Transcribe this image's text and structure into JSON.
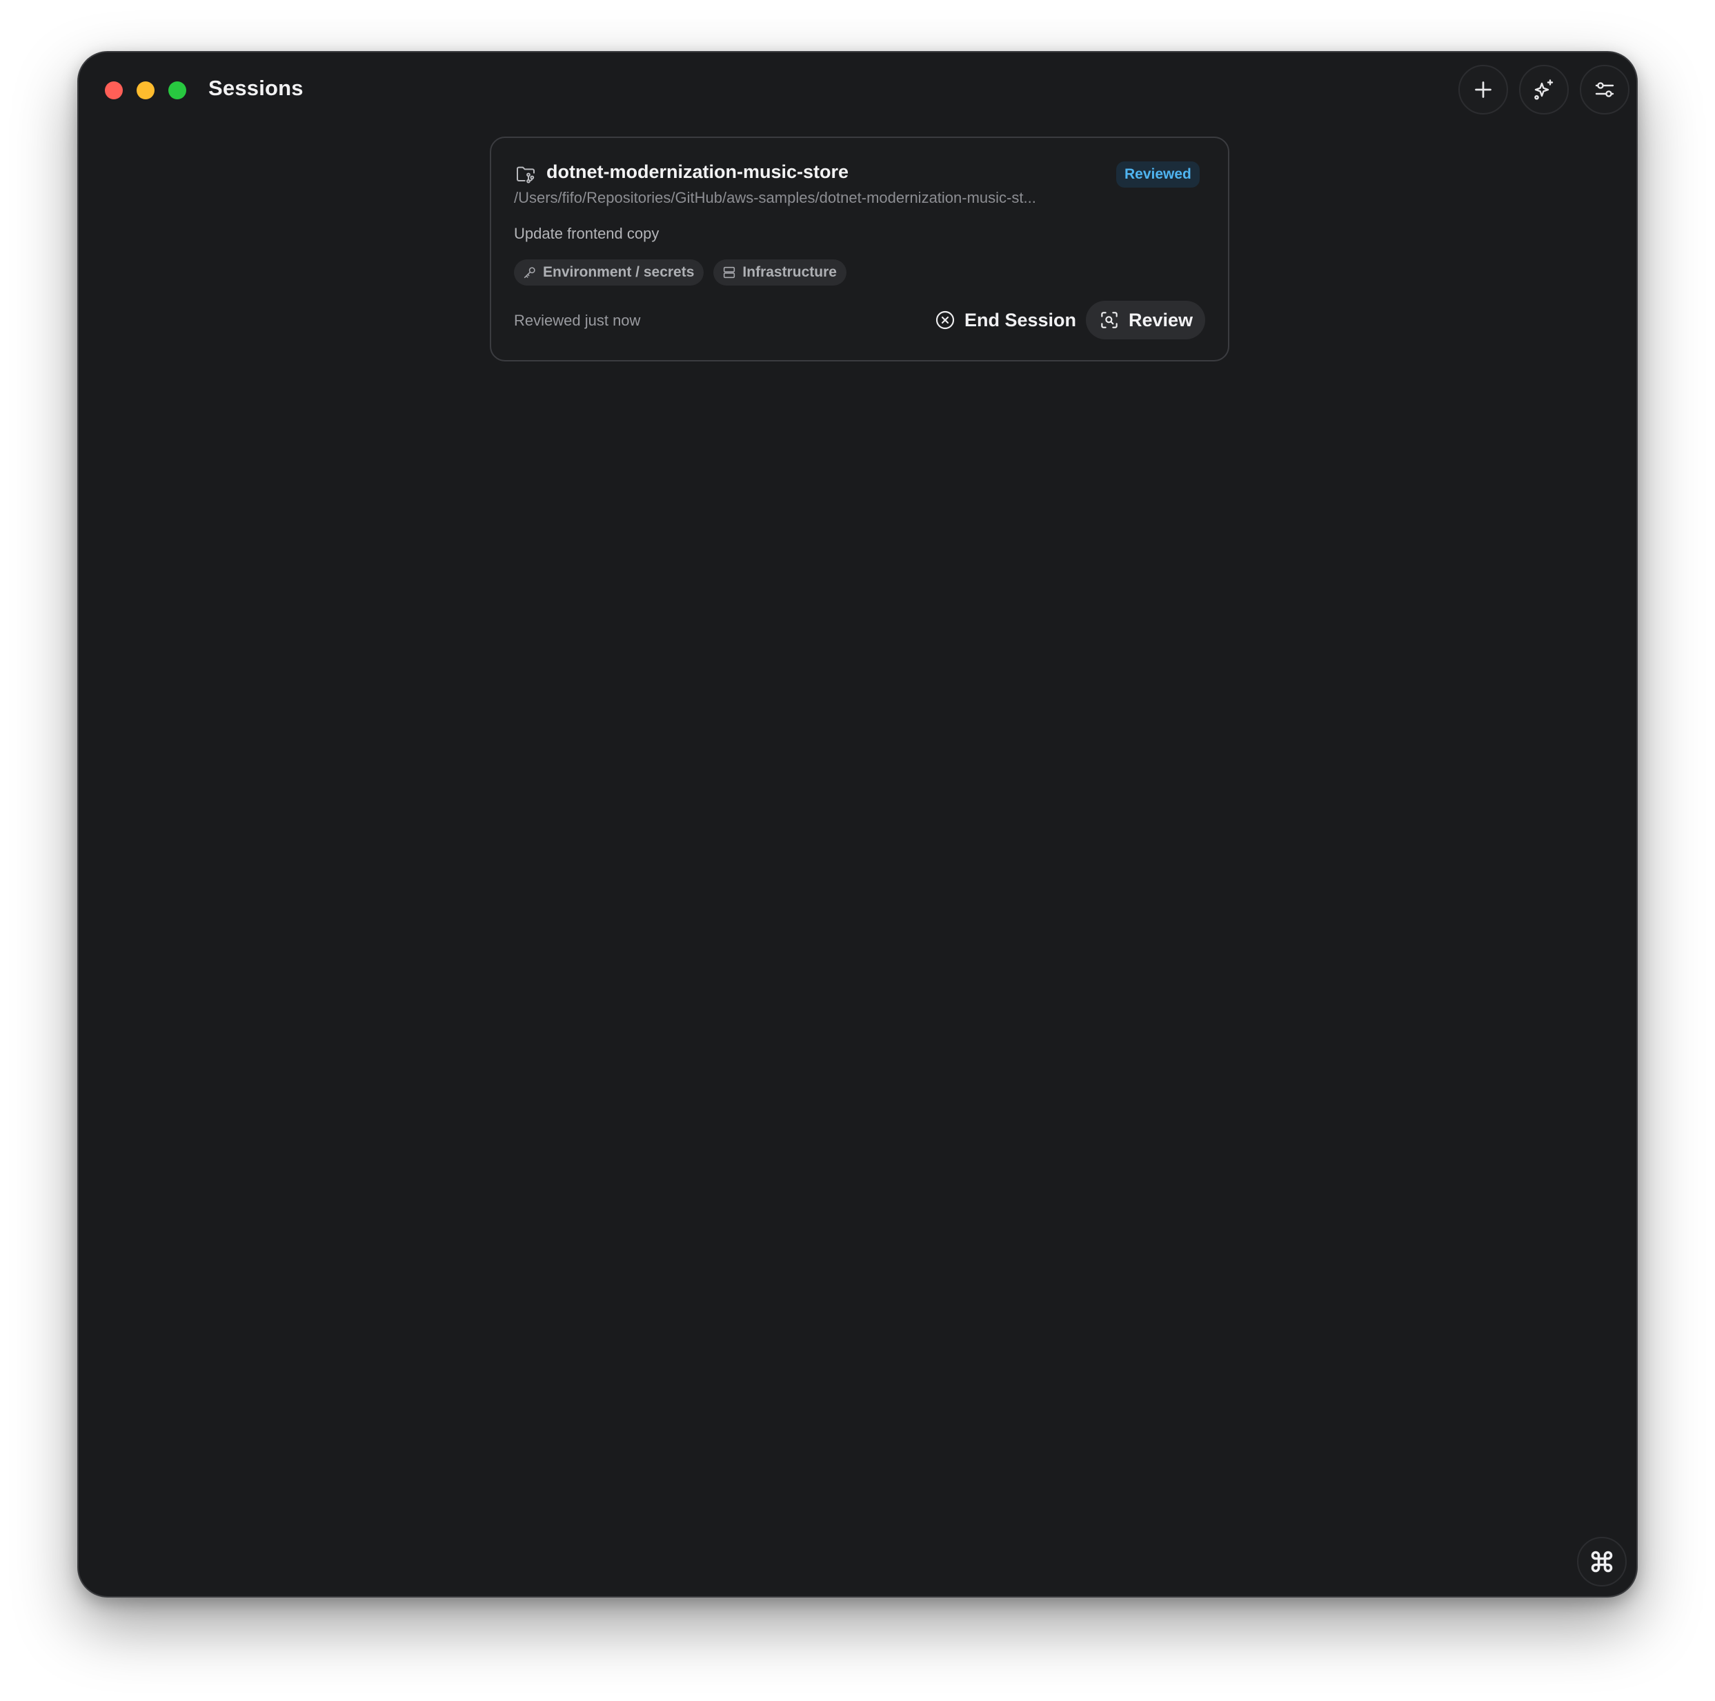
{
  "window": {
    "title": "Sessions"
  },
  "toolbar": {
    "buttons": [
      {
        "name": "new-session",
        "icon": "plus-icon"
      },
      {
        "name": "sparkle",
        "icon": "sparkles-icon"
      },
      {
        "name": "filter",
        "icon": "sliders-icon"
      }
    ]
  },
  "session": {
    "repo_name": "dotnet-modernization-music-store",
    "status": "Reviewed",
    "path": "/Users/fifo/Repositories/GitHub/aws-samples/dotnet-modernization-music-st...",
    "task": "Update frontend copy",
    "tags": [
      {
        "label": "Environment / secrets",
        "icon": "key-icon"
      },
      {
        "label": "Infrastructure",
        "icon": "server-icon"
      }
    ],
    "reviewed_time": "Reviewed just now",
    "end_label": "End Session",
    "review_label": "Review"
  },
  "colors": {
    "window_bg": "#1a1b1d",
    "badge_text": "#4fb4f0",
    "badge_bg": "#1b2c3a",
    "close": "#ff5f57",
    "minimize": "#febc2e",
    "maximize": "#28c840"
  },
  "footer": {
    "command_icon": "command-icon"
  }
}
